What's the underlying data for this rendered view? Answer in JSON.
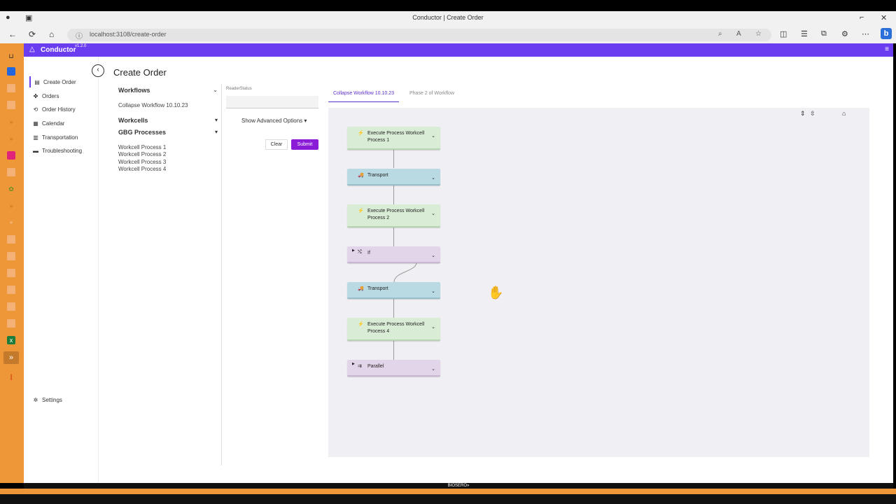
{
  "browser": {
    "tab_title": "Conductor | Create Order",
    "url": "localhost:3108/create-order",
    "back_icon": "←",
    "refresh_icon": "⟳",
    "home_icon": "⌂",
    "more_icon": "⋯",
    "bing_icon": "b"
  },
  "app": {
    "name": "Conductor",
    "version": "v1.2.0",
    "accent": "#6b3df0",
    "footer_brand": "BIOSERO»"
  },
  "sidebar": {
    "items": [
      {
        "label": "Create Order",
        "icon": "▤"
      },
      {
        "label": "Orders",
        "icon": "✤"
      },
      {
        "label": "Order History",
        "icon": "⟲"
      },
      {
        "label": "Calendar",
        "icon": "▦"
      },
      {
        "label": "Transportation",
        "icon": "▥"
      },
      {
        "label": "Troubleshooting",
        "icon": "▬"
      }
    ],
    "settings": {
      "label": "Settings",
      "icon": "✲"
    }
  },
  "page": {
    "title": "Create Order"
  },
  "workflows": {
    "heading": "Workflows",
    "items": [
      "Collapse Workflow 10.10.23"
    ]
  },
  "workcells": {
    "heading": "Workcells"
  },
  "gbg": {
    "heading": "GBG Processes",
    "items": [
      "Workcell Process 1",
      "Workcell Process 2",
      "Workcell Process 3",
      "Workcell Process 4"
    ]
  },
  "form": {
    "field_label": "ReaderStatus",
    "field_value": "",
    "advanced": "Show Advanced Options",
    "clear": "Clear",
    "submit": "Submit"
  },
  "tabs": [
    "Collapse Workflow 10.10.23",
    "Phase 2 of Workflow"
  ],
  "flow_nodes": [
    {
      "label": "Execute Process Workcell Process 1",
      "kind": "green",
      "icon": "⚡"
    },
    {
      "label": "Transport",
      "kind": "blue",
      "icon": "🚚"
    },
    {
      "label": "Execute Process Workcell Process 2",
      "kind": "green",
      "icon": "⚡"
    },
    {
      "label": "If",
      "kind": "purple",
      "icon": "⤭"
    },
    {
      "label": "Transport",
      "kind": "blue",
      "icon": "🚚"
    },
    {
      "label": "Execute Process Workcell Process 4",
      "kind": "green",
      "icon": "⚡"
    },
    {
      "label": "Parallel",
      "kind": "purple",
      "icon": "⇉"
    }
  ]
}
